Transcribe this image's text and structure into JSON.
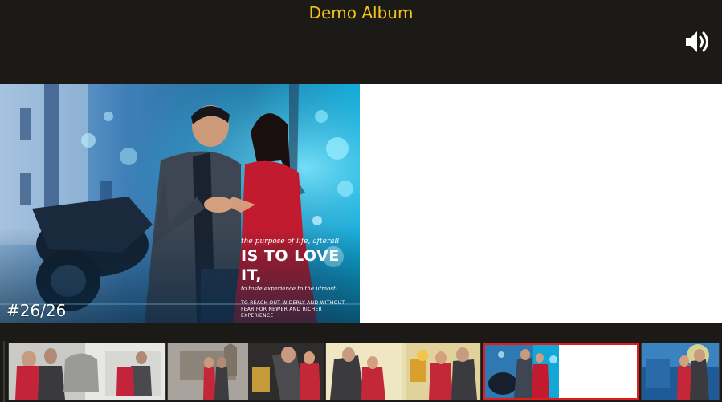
{
  "header": {
    "title": "Demo Album"
  },
  "viewer": {
    "page_counter": "#26/26",
    "quote": {
      "line1": "the purpose of life, afterall",
      "line2": "IS TO LOVE IT,",
      "line3": "to taste experience to the utmost!",
      "line4": "TO REACH OUT WIDERLY AND WITHOUT FEAR FOR NEWER AND RICHER EXPERIENCE"
    }
  },
  "thumbnails": {
    "selected_index": 3
  },
  "colors": {
    "title": "#f2c318",
    "selected_border": "#e21d1d",
    "background": "#1b1a16"
  },
  "icons": {
    "speaker": "volume-icon"
  }
}
